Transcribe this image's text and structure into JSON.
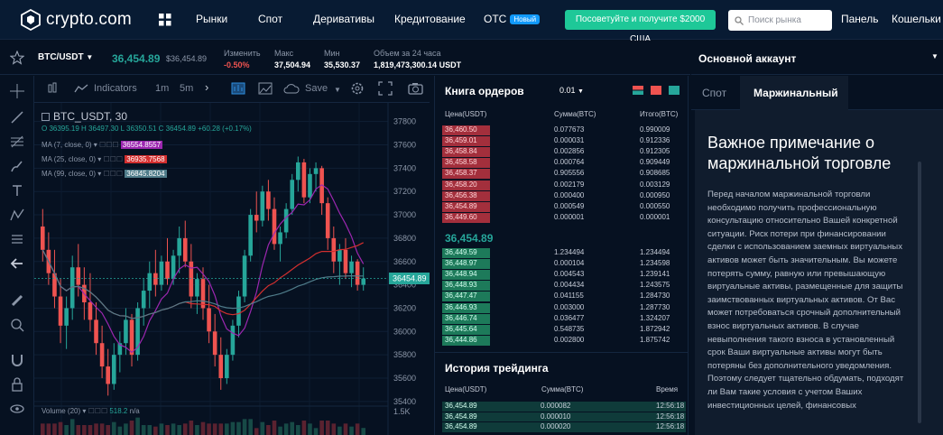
{
  "brand": {
    "name": "crypto.com"
  },
  "nav": {
    "items": [
      "Рынки",
      "Спот",
      "Деривативы",
      "Кредитование",
      "OTC"
    ],
    "otc_badge": "Новый",
    "promo": "Посоветуйте и получите $2000 США",
    "search_placeholder": "Поиск рынка",
    "panel": "Панель",
    "wallets": "Кошельки"
  },
  "ticker": {
    "pair": "BTC/USDT",
    "last": "36,454.89",
    "last_usd": "$36,454.89",
    "change_label": "Изменить",
    "change": "-0.50%",
    "high_label": "Макс",
    "high": "37,504.94",
    "low_label": "Мин",
    "low": "35,530.37",
    "volume_label": "Объем за 24 часа",
    "volume": "1,819,473,300.14 USDT"
  },
  "chart_toolbar": {
    "indicators": "Indicators",
    "tf1": "1m",
    "tf2": "5m",
    "save": "Save"
  },
  "chart_data": {
    "type": "candlestick",
    "symbol": "BTC_USDT, 30",
    "ohlc": {
      "o": "O 36395.19",
      "h": "H 36497.30",
      "l": "L 36350.51",
      "c": "C 36454.89",
      "chg": "+60.28 (+0.17%)"
    },
    "ma": [
      {
        "label": "MA (7, close, 0)",
        "value": "36554.8557",
        "color": "#9c27b0"
      },
      {
        "label": "MA (25, close, 0)",
        "value": "36935.7568",
        "color": "#d32f2f"
      },
      {
        "label": "MA (99, close, 0)",
        "value": "36845.8204",
        "color": "#4f7c8a"
      }
    ],
    "y_ticks": [
      37800,
      37600,
      37400,
      37200,
      37000,
      36800,
      36600,
      36400,
      36200,
      36000,
      35800,
      35600,
      35400
    ],
    "ylim": [
      35360,
      37960
    ],
    "last_price": 36454.89,
    "last_price_label": "36454.89",
    "volume_label": "Volume (20)",
    "volume_value": "518.2",
    "volume_na": "n/a",
    "volume_tick": "1.5K",
    "candles": [
      [
        36900,
        37050,
        36600,
        36700
      ],
      [
        36700,
        36850,
        36400,
        36500
      ],
      [
        36500,
        36700,
        36200,
        36300
      ],
      [
        36300,
        36450,
        35900,
        36050
      ],
      [
        36050,
        36300,
        35850,
        36200
      ],
      [
        36200,
        36650,
        36100,
        36550
      ],
      [
        36550,
        36750,
        36300,
        36400
      ],
      [
        36400,
        36550,
        36100,
        36250
      ],
      [
        36250,
        36500,
        36000,
        36100
      ],
      [
        36100,
        36250,
        35800,
        35900
      ],
      [
        35900,
        36050,
        35600,
        35700
      ],
      [
        35700,
        35850,
        35450,
        35550
      ],
      [
        35550,
        35900,
        35500,
        35800
      ],
      [
        35800,
        36000,
        35650,
        35900
      ],
      [
        35900,
        36200,
        35800,
        36100
      ],
      [
        36100,
        36150,
        35700,
        35800
      ],
      [
        35800,
        36250,
        35750,
        36200
      ],
      [
        36200,
        36450,
        36050,
        36350
      ],
      [
        36350,
        36600,
        36200,
        36500
      ],
      [
        36500,
        36700,
        36300,
        36400
      ],
      [
        36400,
        36650,
        36350,
        36600
      ],
      [
        36600,
        36800,
        36400,
        36450
      ],
      [
        36450,
        36700,
        36400,
        36650
      ],
      [
        36650,
        36900,
        36500,
        36800
      ],
      [
        36800,
        36950,
        36550,
        36600
      ],
      [
        36600,
        36750,
        36200,
        36300
      ],
      [
        36300,
        36500,
        36150,
        36450
      ],
      [
        36450,
        36550,
        36100,
        36200
      ],
      [
        36200,
        36400,
        35900,
        36000
      ],
      [
        36000,
        36150,
        35700,
        35800
      ],
      [
        35800,
        35950,
        35500,
        35600
      ],
      [
        35600,
        35850,
        35550,
        35800
      ],
      [
        35800,
        36100,
        35750,
        36050
      ],
      [
        36050,
        36350,
        35950,
        36300
      ],
      [
        36300,
        36700,
        36250,
        36650
      ],
      [
        36650,
        37050,
        36600,
        37000
      ],
      [
        37000,
        37200,
        36850,
        36950
      ],
      [
        36950,
        37250,
        36900,
        37200
      ],
      [
        37200,
        37300,
        36950,
        37050
      ],
      [
        37050,
        37150,
        36700,
        36750
      ],
      [
        36750,
        36900,
        36600,
        36850
      ],
      [
        36850,
        37100,
        36800,
        37050
      ],
      [
        37050,
        37350,
        37000,
        37300
      ],
      [
        37300,
        37500,
        37200,
        37450
      ],
      [
        37450,
        37480,
        37100,
        37150
      ],
      [
        37150,
        37400,
        37100,
        37350
      ],
      [
        37350,
        37450,
        37200,
        37400
      ],
      [
        37400,
        37420,
        37000,
        37100
      ],
      [
        37100,
        37150,
        36700,
        36800
      ],
      [
        36800,
        36900,
        36500,
        36600
      ],
      [
        36600,
        36750,
        36400,
        36700
      ],
      [
        36700,
        36800,
        36450,
        36500
      ],
      [
        36500,
        36650,
        36380,
        36600
      ],
      [
        36600,
        36620,
        36350,
        36400
      ],
      [
        36400,
        36550,
        36350,
        36455
      ]
    ]
  },
  "orderbook": {
    "title": "Книга ордеров",
    "precision": "0.01",
    "headers": [
      "Цена(USDT)",
      "Сумма(BTC)",
      "Итого(BTC)"
    ],
    "asks": [
      [
        "36,460.50",
        "0.077673",
        "0.990009"
      ],
      [
        "36,459.01",
        "0.000031",
        "0.912336"
      ],
      [
        "36,458.84",
        "0.002856",
        "0.912305"
      ],
      [
        "36,458.58",
        "0.000764",
        "0.909449"
      ],
      [
        "36,458.37",
        "0.905556",
        "0.908685"
      ],
      [
        "36,458.20",
        "0.002179",
        "0.003129"
      ],
      [
        "36,456.38",
        "0.000400",
        "0.000950"
      ],
      [
        "36,454.89",
        "0.000549",
        "0.000550"
      ],
      [
        "36,449.60",
        "0.000001",
        "0.000001"
      ]
    ],
    "mid": "36,454.89",
    "bids": [
      [
        "36,449.59",
        "1.234494",
        "1.234494"
      ],
      [
        "36,448.97",
        "0.000104",
        "1.234598"
      ],
      [
        "36,448.94",
        "0.004543",
        "1.239141"
      ],
      [
        "36,448.93",
        "0.004434",
        "1.243575"
      ],
      [
        "36,447.47",
        "0.041155",
        "1.284730"
      ],
      [
        "36,446.93",
        "0.003000",
        "1.287730"
      ],
      [
        "36,446.74",
        "0.036477",
        "1.324207"
      ],
      [
        "36,445.64",
        "0.548735",
        "1.872942"
      ],
      [
        "36,444.86",
        "0.002800",
        "1.875742"
      ]
    ]
  },
  "trades": {
    "title": "История трейдинга",
    "headers": [
      "Цена(USDT)",
      "Сумма(BTC)",
      "Время"
    ],
    "rows": [
      [
        "36,454.89",
        "0.000082",
        "12:56:18"
      ],
      [
        "36,454.89",
        "0.000010",
        "12:56:18"
      ],
      [
        "36,454.89",
        "0.000020",
        "12:56:18"
      ]
    ]
  },
  "account": {
    "label": "Основной аккаунт",
    "tab_spot": "Спот",
    "tab_margin": "Маржинальный"
  },
  "note": {
    "title": "Важное примечание о маржинальной торговле",
    "lines": [
      "Перед началом маржинальной торговли",
      "необходимо получить профессиональную",
      "консультацию относительно Вашей конкретной",
      "ситуации. Риск потери при финансировании",
      "сделки с использованием заемных виртуальных",
      "активов может быть значительным. Вы можете",
      "потерять сумму, равную или превышающую",
      "виртуальные активы, размещенные для защиты",
      "заимствованных виртуальных активов. От Вас",
      "может потребоваться срочный дополнительный",
      "взнос виртуальных активов. В случае",
      "невыполнения такого взноса в установленный",
      "срок Ваши виртуальные активы могут быть",
      "потеряны без дополнительного уведомления.",
      "Поэтому следует тщательно обдумать, подходят",
      "ли Вам такие условия с учетом Ваших",
      "инвестиционных целей, финансовых"
    ]
  },
  "colors": {
    "up": "#26a69a",
    "down": "#ef5350",
    "bg": "#061121",
    "accent": "#1ec898"
  }
}
